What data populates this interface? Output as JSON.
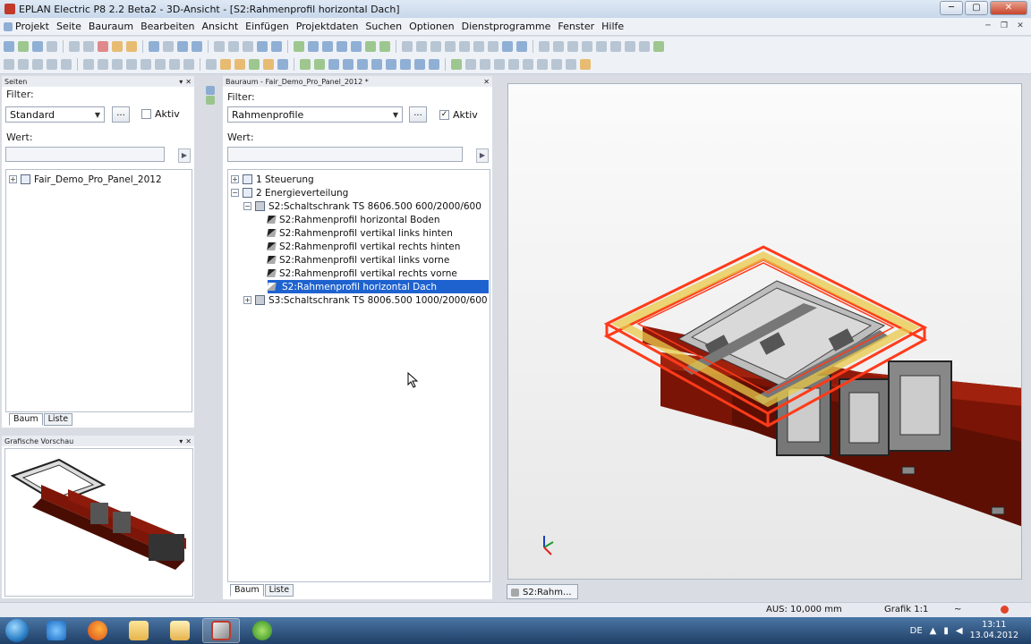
{
  "window": {
    "title": "EPLAN Electric P8 2.2 Beta2 - 3D-Ansicht - [S2:Rahmenprofil horizontal Dach]",
    "buttons": {
      "minimize": "─",
      "maximize": "▢",
      "close": "✕"
    }
  },
  "menu": {
    "items": [
      "Projekt",
      "Seite",
      "Bauraum",
      "Bearbeiten",
      "Ansicht",
      "Einfügen",
      "Projektdaten",
      "Suchen",
      "Optionen",
      "Dienstprogramme",
      "Fenster",
      "Hilfe"
    ],
    "mdi": {
      "minimize": "─",
      "restore": "❐",
      "close": "✕"
    }
  },
  "pages_panel": {
    "title": "Seiten",
    "filter_label": "Filter:",
    "filter_value": "Standard",
    "more_button": "...",
    "aktiv_label": "Aktiv",
    "aktiv_checked": false,
    "wert_label": "Wert:",
    "wert_value": "",
    "tree": [
      "Fair_Demo_Pro_Panel_2012"
    ],
    "tabs": [
      "Baum",
      "Liste"
    ]
  },
  "preview_panel": {
    "title": "Grafische Vorschau"
  },
  "bauraum_panel": {
    "title": "Bauraum - Fair_Demo_Pro_Panel_2012 *",
    "filter_label": "Filter:",
    "filter_value": "Rahmenprofile",
    "more_button": "...",
    "aktiv_label": "Aktiv",
    "aktiv_checked": true,
    "wert_label": "Wert:",
    "wert_value": "",
    "tree": [
      {
        "label": "1 Steuerung",
        "level": 0,
        "expander": "+",
        "icon": "page"
      },
      {
        "label": "2 Energieverteilung",
        "level": 0,
        "expander": "−",
        "icon": "page"
      },
      {
        "label": "S2:Schaltschrank TS 8606.500  600/2000/600",
        "level": 1,
        "expander": "−",
        "icon": "cabinet"
      },
      {
        "label": "S2:Rahmenprofil horizontal Boden",
        "level": 2,
        "icon": "frame"
      },
      {
        "label": "S2:Rahmenprofil vertikal links hinten",
        "level": 2,
        "icon": "frame"
      },
      {
        "label": "S2:Rahmenprofil vertikal rechts hinten",
        "level": 2,
        "icon": "frame"
      },
      {
        "label": "S2:Rahmenprofil vertikal links vorne",
        "level": 2,
        "icon": "frame"
      },
      {
        "label": "S2:Rahmenprofil vertikal rechts vorne",
        "level": 2,
        "icon": "frame"
      },
      {
        "label": "S2:Rahmenprofil horizontal Dach",
        "level": 2,
        "icon": "frame",
        "selected": true
      },
      {
        "label": "S3:Schaltschrank TS 8006.500  1000/2000/600",
        "level": 1,
        "expander": "+",
        "icon": "cabinet"
      }
    ],
    "tabs": [
      "Baum",
      "Liste"
    ]
  },
  "document_tab": "S2:Rahm...",
  "status": {
    "aus": "AUS: 10,000 mm",
    "grafik": "Grafik 1:1",
    "tilde": "~"
  },
  "taskbar": {
    "language": "DE",
    "time": "13:11",
    "date": "13.04.2012"
  },
  "colors": {
    "selection": "#1e62d0",
    "highlight_frame": "#ff3b1a",
    "highlight_fill": "#e9c94a",
    "busbar": "#8e1a0c"
  }
}
